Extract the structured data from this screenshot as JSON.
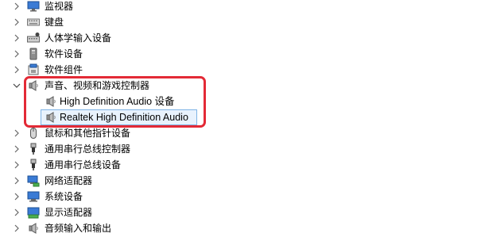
{
  "tree": {
    "items": [
      {
        "label": "监视器",
        "icon": "monitor-icon",
        "expanded": false
      },
      {
        "label": "键盘",
        "icon": "keyboard-icon",
        "expanded": false
      },
      {
        "label": "人体学输入设备",
        "icon": "hid-icon",
        "expanded": false
      },
      {
        "label": "软件设备",
        "icon": "software-device-icon",
        "expanded": false
      },
      {
        "label": "软件组件",
        "icon": "software-component-icon",
        "expanded": false
      },
      {
        "label": "声音、视频和游戏控制器",
        "icon": "speaker-icon",
        "expanded": true,
        "children": [
          {
            "label": "High Definition Audio 设备",
            "icon": "speaker-icon",
            "selected": false
          },
          {
            "label": "Realtek High Definition Audio",
            "icon": "speaker-icon",
            "selected": true
          }
        ]
      },
      {
        "label": "鼠标和其他指针设备",
        "icon": "mouse-icon",
        "expanded": false
      },
      {
        "label": "通用串行总线控制器",
        "icon": "usb-icon",
        "expanded": false
      },
      {
        "label": "通用串行总线设备",
        "icon": "usb-icon",
        "expanded": false
      },
      {
        "label": "网络适配器",
        "icon": "network-icon",
        "expanded": false
      },
      {
        "label": "系统设备",
        "icon": "system-device-icon",
        "expanded": false
      },
      {
        "label": "显示适配器",
        "icon": "display-adapter-icon",
        "expanded": false
      },
      {
        "label": "音频输入和输出",
        "icon": "speaker-icon",
        "expanded": false
      }
    ]
  },
  "colors": {
    "selection_border": "#7fb4e6",
    "selection_fill": "#e8f2fd",
    "annotation_red": "#e32a36"
  }
}
